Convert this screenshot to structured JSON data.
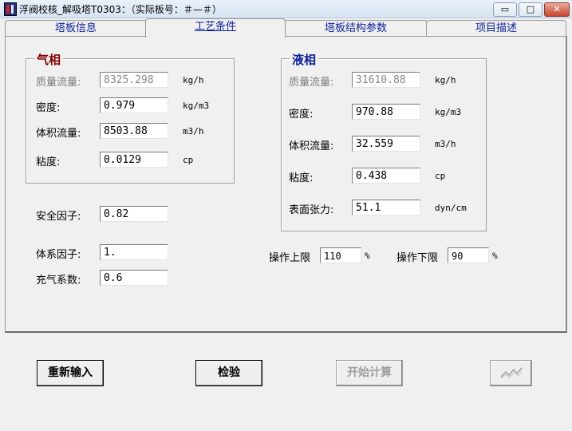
{
  "window": {
    "title": "浮阀校核_解吸塔T0303：（实际板号：＃—＃）",
    "minimize_label": "▭",
    "maximize_label": "□",
    "close_label": "✕"
  },
  "tabs": [
    {
      "label": "塔板信息"
    },
    {
      "label": "工艺条件"
    },
    {
      "label": "塔板结构参数"
    },
    {
      "label": "项目描述"
    }
  ],
  "gas": {
    "title": "气相",
    "title_color": "#800000",
    "mass_flow": {
      "label": "质量流量:",
      "value": "8325.298",
      "unit": "kg/h"
    },
    "density": {
      "label": "密度:",
      "value": "0.979",
      "unit": "kg/m3"
    },
    "volume_flow": {
      "label": "体积流量:",
      "value": "8503.88",
      "unit": "m3/h"
    },
    "viscosity": {
      "label": "粘度:",
      "value": "0.0129",
      "unit": "cp"
    }
  },
  "liquid": {
    "title": "液相",
    "title_color": "#0a1f9e",
    "mass_flow": {
      "label": "质量流量:",
      "value": "31610.88",
      "unit": "kg/h"
    },
    "density": {
      "label": "密度:",
      "value": "970.88",
      "unit": "kg/m3"
    },
    "volume_flow": {
      "label": "体积流量:",
      "value": "32.559",
      "unit": "m3/h"
    },
    "viscosity": {
      "label": "粘度:",
      "value": "0.438",
      "unit": "cp"
    },
    "surface_tension": {
      "label": "表面张力:",
      "value": "51.1",
      "unit": "dyn/cm"
    }
  },
  "factors": {
    "safety": {
      "label": "安全因子:",
      "value": "0.82"
    },
    "system": {
      "label": "体系因子:",
      "value": "1."
    },
    "aeration": {
      "label": "充气系数:",
      "value": "0.6"
    }
  },
  "operation": {
    "upper": {
      "label": "操作上限",
      "value": "110",
      "unit": "%"
    },
    "lower": {
      "label": "操作下限",
      "value": "90",
      "unit": "%"
    }
  },
  "buttons": {
    "reset": "重新输入",
    "check": "检验",
    "calculate": "开始计算",
    "chart_icon": "chart-icon"
  }
}
